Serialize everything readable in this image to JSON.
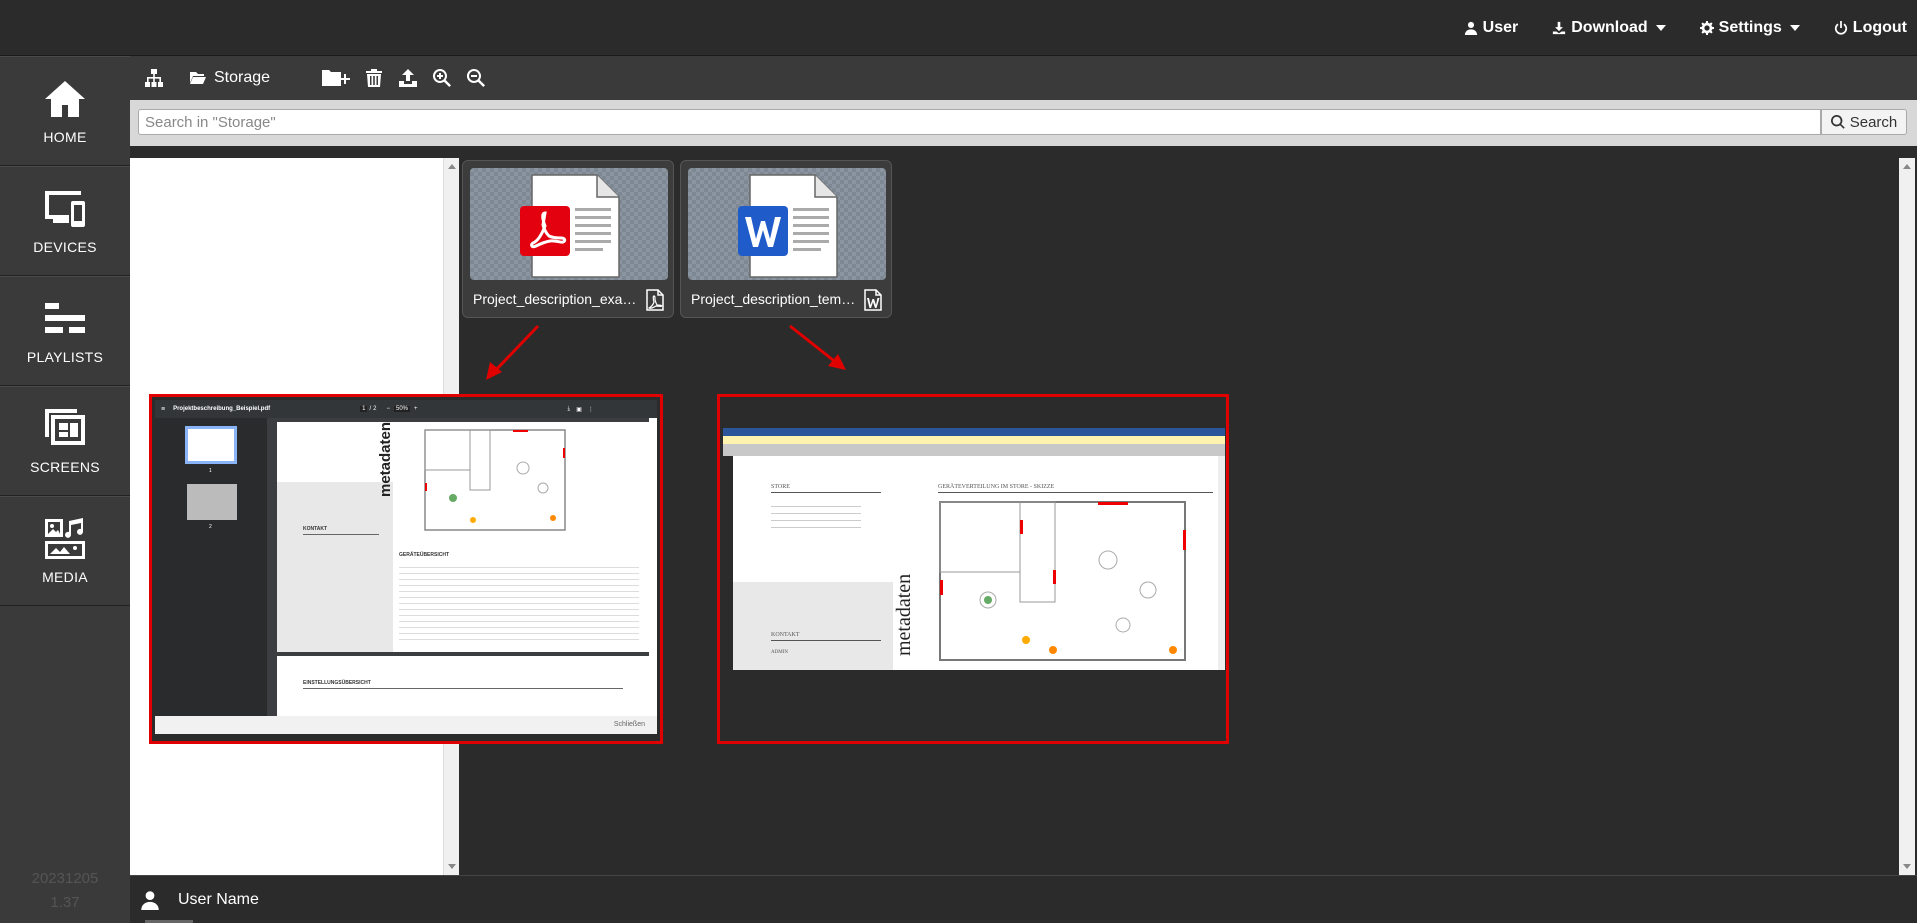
{
  "topnav": {
    "user": "User",
    "download": "Download",
    "settings": "Settings",
    "logout": "Logout"
  },
  "sidebar": {
    "items": [
      {
        "label": "HOME",
        "icon": "home-icon"
      },
      {
        "label": "DEVICES",
        "icon": "devices-icon"
      },
      {
        "label": "PLAYLISTS",
        "icon": "playlists-icon"
      },
      {
        "label": "SCREENS",
        "icon": "screens-icon"
      },
      {
        "label": "MEDIA",
        "icon": "media-icon"
      }
    ],
    "version_date": "20231205",
    "version_num": "1.37"
  },
  "toolbar": {
    "storage_label": "Storage",
    "icons": [
      "sitemap-icon",
      "folder-open-icon",
      "new-folder-icon",
      "trash-icon",
      "upload-icon",
      "zoom-in-icon",
      "zoom-out-icon"
    ]
  },
  "search": {
    "placeholder": "Search in \"Storage\"",
    "button_label": "Search"
  },
  "files": [
    {
      "name": "Project_description_exam...",
      "type": "pdf"
    },
    {
      "name": "Project_description_temp...",
      "type": "word"
    }
  ],
  "previews": {
    "pdf": {
      "filename": "Projektbeschreibung_Beispiel.pdf",
      "page": "1",
      "pages": "2",
      "zoom": "50%",
      "close_label": "Schließen",
      "vertical_label": "metadaten",
      "section_contact": "KONTAKT",
      "section_overview": "GERÄTEÜBERSICHT",
      "section_settings": "EINSTELLUNGSÜBERSICHT",
      "thumb_page1": "1",
      "thumb_page2": "2"
    },
    "word": {
      "heading_store": "STORE",
      "heading_layout": "GERÄTEVERTEILUNG IM STORE - SKIZZE",
      "vertical_label": "metadaten",
      "section_contact": "KONTAKT",
      "section_admin": "ADMIN"
    }
  },
  "colors": {
    "accent_red": "#e00000",
    "pdf_red": "#e3000f",
    "word_blue": "#1f5cc9"
  },
  "bottombar": {
    "username": "User Name"
  }
}
